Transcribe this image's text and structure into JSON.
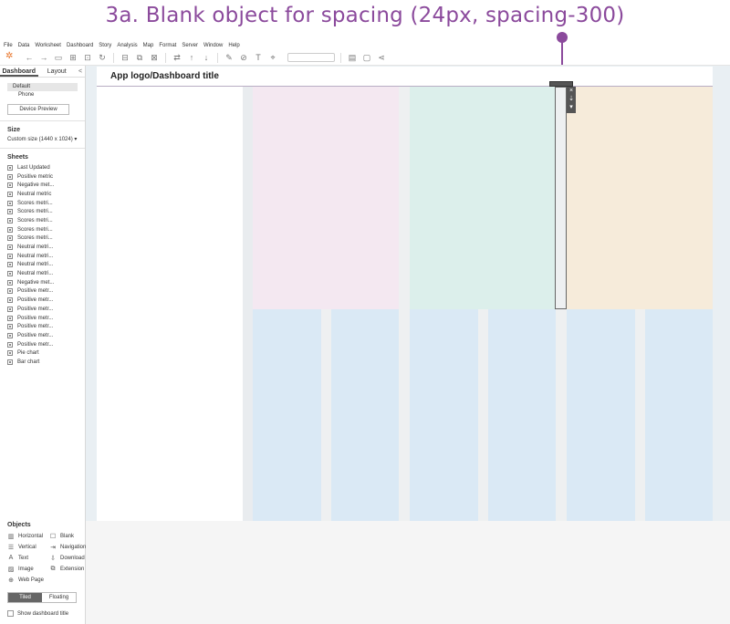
{
  "headline": "3a. Blank object for spacing (24px, spacing-300)",
  "colors": {
    "annotation": "#8b4a9c",
    "pink_panel": "#f4e8f1",
    "green_panel": "#dcefeb",
    "peach_panel": "#f6ebda",
    "blue_panel": "#dae9f5"
  },
  "menu": [
    "File",
    "Data",
    "Worksheet",
    "Dashboard",
    "Story",
    "Analysis",
    "Map",
    "Format",
    "Server",
    "Window",
    "Help"
  ],
  "toolbar_icons": [
    "tableau-logo-icon",
    "undo-icon",
    "redo-icon",
    "save-icon",
    "new-datasource-icon",
    "new-sheet-icon",
    "refresh-icon",
    "pause-icon",
    "duplicate-icon",
    "clear-icon",
    "swap-icon",
    "sort-asc-icon",
    "sort-desc-icon",
    "highlight-icon",
    "group-icon",
    "labels-icon",
    "fix-axes-icon",
    "fit-dropdown",
    "show-cards-icon",
    "presentation-icon",
    "share-icon"
  ],
  "sidebar": {
    "tabs": [
      "Dashboard",
      "Layout"
    ],
    "collapse": "<",
    "devices": [
      "Default",
      "Phone"
    ],
    "device_preview": "Device Preview",
    "size_title": "Size",
    "size_value": "Custom size (1440 x 1024) ▾",
    "sheets_title": "Sheets",
    "sheets": [
      "Last Updated",
      "Positive metric",
      "Negative met...",
      "Neutral metric",
      "Scores metri...",
      "Scores metri...",
      "Scores metri...",
      "Scores metri...",
      "Scores metri...",
      "Neutral metri...",
      "Neutral metri...",
      "Neutral metri...",
      "Neutral metri...",
      "Negative met...",
      "Positive metr...",
      "Positive metr...",
      "Positive metr...",
      "Positive metr...",
      "Positive metr...",
      "Positive metr...",
      "Positive metr...",
      "Pie chart",
      "Bar chart"
    ],
    "objects_title": "Objects",
    "objects": [
      {
        "icon": "horizontal-icon",
        "glyph": "▥",
        "label": "Horizontal"
      },
      {
        "icon": "blank-icon",
        "glyph": "☐",
        "label": "Blank"
      },
      {
        "icon": "vertical-icon",
        "glyph": "☰",
        "label": "Vertical"
      },
      {
        "icon": "navigation-icon",
        "glyph": "⇥",
        "label": "Navigation"
      },
      {
        "icon": "text-icon",
        "glyph": "A",
        "label": "Text"
      },
      {
        "icon": "download-icon",
        "glyph": "⇩",
        "label": "Download"
      },
      {
        "icon": "image-icon",
        "glyph": "▨",
        "label": "Image"
      },
      {
        "icon": "extension-icon",
        "glyph": "⧉",
        "label": "Extension"
      },
      {
        "icon": "web-page-icon",
        "glyph": "⊕",
        "label": "Web Page"
      }
    ],
    "tiled": "Tiled",
    "floating": "Floating",
    "show_title": "Show dashboard title"
  },
  "dashboard": {
    "title": "App logo/Dashboard title",
    "spacer_tools": [
      "×",
      "⇣",
      "▾"
    ]
  }
}
